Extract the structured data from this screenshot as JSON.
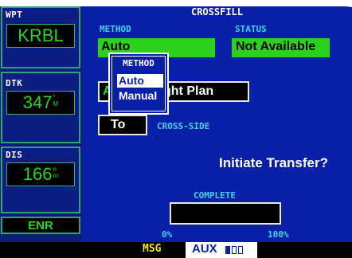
{
  "left_panel": {
    "fields": [
      {
        "label": "WPT",
        "value": "KRBL",
        "unit_top": "",
        "unit_bottom": ""
      },
      {
        "label": "DTK",
        "value": "347",
        "unit_top": "°",
        "unit_bottom": "M"
      },
      {
        "label": "DIS",
        "value": "166",
        "unit_top": "n",
        "unit_bottom": "m"
      }
    ],
    "mode": "ENR"
  },
  "page": {
    "title": "CROSSFILL",
    "method_label": "METHOD",
    "status_label": "STATUS",
    "method_value": "Auto",
    "status_value": "Not Available",
    "source_partial": "A",
    "source_value": "ght Plan",
    "cross_value": "To",
    "cross_label": "CROSS-SIDE",
    "initiate_label": "Initiate Transfer?",
    "complete_label": "COMPLETE",
    "progress_min": "0%",
    "progress_max": "100%",
    "progress_fraction": 0
  },
  "popup": {
    "title": "METHOD",
    "options": [
      "Auto",
      "Manual"
    ],
    "selected": "Auto"
  },
  "status_bar": {
    "msg": "MSG",
    "aux": "AUX"
  },
  "colors": {
    "screen_bg": "#0a1fa8",
    "field_green": "#2cd21c",
    "label_cyan": "#38d6ea",
    "msg_yellow": "#f2e41c"
  }
}
